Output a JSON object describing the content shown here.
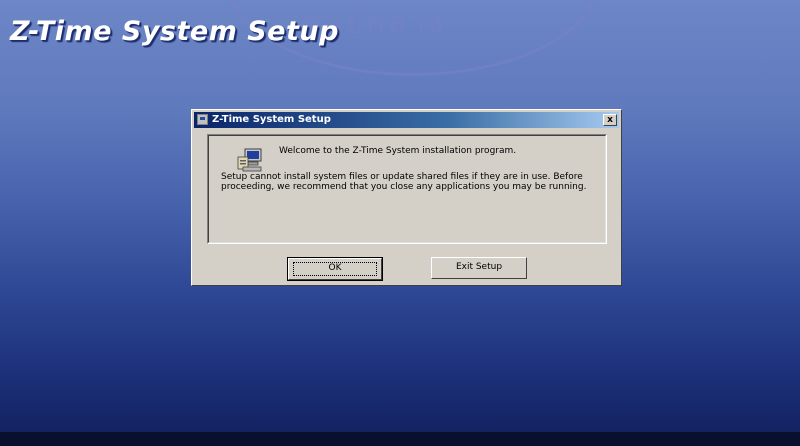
{
  "app": {
    "title": "Z-Time System Setup",
    "watermark": "ศูนย์กลาง"
  },
  "dialog": {
    "title": "Z-Time System Setup",
    "close_label": "x",
    "welcome": "Welcome to the Z-Time System installation program.",
    "warning": "Setup cannot install system files or update shared files if they are in use. Before proceeding, we recommend that you close any applications you may be running.",
    "ok_label": "OK",
    "exit_label": "Exit Setup"
  },
  "icons": {
    "title": "setup-icon",
    "content": "computer-setup-icon",
    "close": "close-icon"
  },
  "colors": {
    "titlebar_start": "#0a246a",
    "titlebar_end": "#a6caf0",
    "dialog_face": "#d4d0c8",
    "desktop_top": "#6d86c6",
    "desktop_bottom": "#111f5c"
  }
}
